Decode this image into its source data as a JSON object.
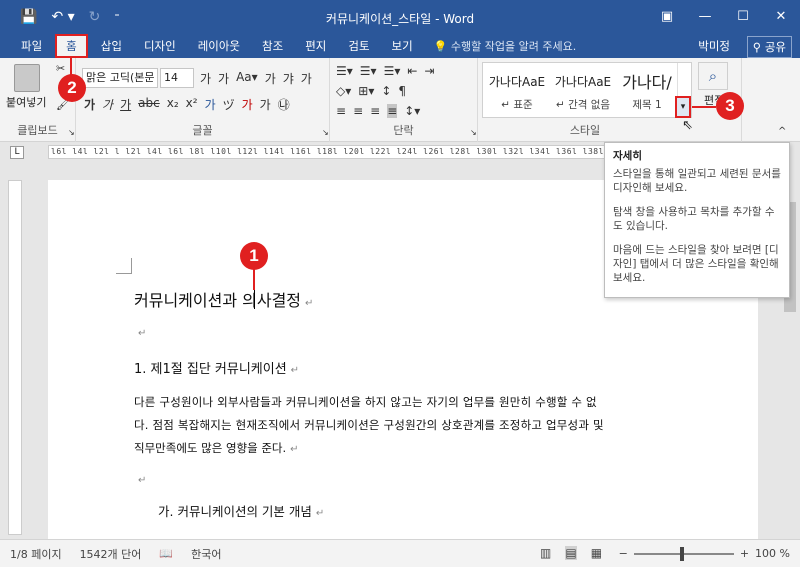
{
  "window": {
    "title": "커뮤니케이션_스타일 - Word",
    "qat_save_icon": "save-icon",
    "qat_undo_icon": "undo-icon",
    "qat_redo_icon": "redo-icon",
    "controls": [
      "restore-ribbon-icon",
      "minimize-icon",
      "maximize-icon",
      "close-icon"
    ]
  },
  "tabs": [
    {
      "label": "파일"
    },
    {
      "label": "홈"
    },
    {
      "label": "삽입"
    },
    {
      "label": "디자인"
    },
    {
      "label": "레이아웃"
    },
    {
      "label": "참조"
    },
    {
      "label": "편지"
    },
    {
      "label": "검토"
    },
    {
      "label": "보기"
    }
  ],
  "tell_me": "수행할 작업을 알려 주세요.",
  "user_name": "박미정",
  "share_label": "공유",
  "ribbon": {
    "clipboard": {
      "paste_label": "붙여넣기",
      "group_label": "클립보드"
    },
    "font": {
      "name": "맑은 고딕(본문",
      "size": "14",
      "group_label": "글꼴"
    },
    "paragraph": {
      "group_label": "단락"
    },
    "styles": {
      "group_label": "스타일",
      "items": [
        {
          "sample": "가나다AaE",
          "name": "↵ 표준"
        },
        {
          "sample": "가나다AaE",
          "name": "↵ 간격 없음"
        },
        {
          "sample": "가나다/",
          "name": "제목 1"
        }
      ]
    },
    "editing": {
      "label": "편집"
    }
  },
  "markers": [
    "1",
    "2",
    "3"
  ],
  "document": {
    "lines": [
      {
        "text": "커뮤니케이션과 의사결정",
        "mark": "↵"
      },
      {
        "text": "",
        "mark": "↵"
      },
      {
        "text": "1. 제1절 집단 커뮤니케이션",
        "mark": "↵"
      },
      {
        "text": "다른 구성원이나 외부사람들과 커뮤니케이션을 하지 않고는 자기의 업무를 원만히 수행할 수 없",
        "mark": ""
      },
      {
        "text": "다. 점점 복잡해지는 현재조직에서 커뮤니케이션은 구성원간의 상호관계를 조정하고 업무성과 및",
        "mark": ""
      },
      {
        "text": "직무만족에도 많은 영향을 준다.",
        "mark": "↵"
      },
      {
        "text": "",
        "mark": "↵"
      },
      {
        "text": "가. 커뮤니케이션의 기본 개념",
        "mark": "↵"
      }
    ]
  },
  "tooltip": {
    "title": "자세히",
    "p1": "스타일을 통해 일관되고 세련된 문서를 디자인해 보세요.",
    "p2": "탐색 창을 사용하고 목차를 추가할 수도 있습니다.",
    "p3": "마음에 드는 스타일을 찾아 보려면 [디자인] 탭에서 더 많은 스타일을 확인해 보세요."
  },
  "status": {
    "page": "1/8 페이지",
    "words": "1542개 단어",
    "language": "한국어",
    "zoom": "100 %"
  },
  "accent": "#2b579a",
  "marker_color": "#e02020"
}
